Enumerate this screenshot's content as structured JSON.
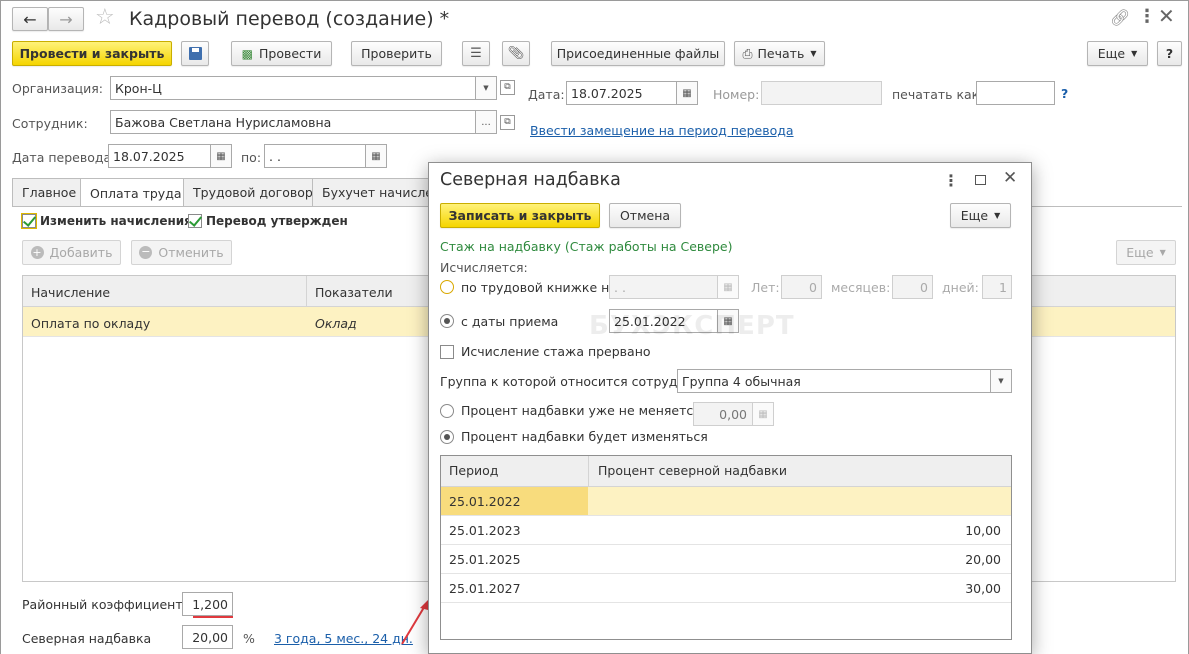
{
  "window": {
    "title": "Кадровый перевод (создание) *"
  },
  "toolbar": {
    "post_close": "Провести и закрыть",
    "post": "Провести",
    "check": "Проверить",
    "attached": "Присоединенные файлы",
    "print": "Печать",
    "more": "Еще",
    "help": "?"
  },
  "form": {
    "org_label": "Организация:",
    "org_value": "Крон-Ц",
    "date_label": "Дата:",
    "date_value": "18.07.2025",
    "number_label": "Номер:",
    "number_value": "",
    "print_as_label": "печатать как:",
    "print_as_value": "",
    "print_as_help": "?",
    "employee_label": "Сотрудник:",
    "employee_value": "Бажова Светлана Нурисламовна",
    "substitution_link": "Ввести замещение на период перевода",
    "transfer_date_label": "Дата перевода:",
    "transfer_date_value": "18.07.2025",
    "to_label": "по:",
    "to_value": " .  ."
  },
  "tabs": [
    "Главное",
    "Оплата труда",
    "Трудовой договор",
    "Бухучет начислен"
  ],
  "pay": {
    "change_accruals": "Изменить начисления",
    "approved": "Перевод утвержден",
    "add": "Добавить",
    "cancel": "Отменить",
    "more": "Еще",
    "columns": [
      "Начисление",
      "Показатели"
    ],
    "rows": [
      {
        "accrual": "Оплата по окладу",
        "indicator": "Оклад"
      }
    ],
    "regional_label": "Районный коэффициент",
    "regional_value": "1,200",
    "northern_label": "Северная надбавка",
    "northern_value": "20,00",
    "northern_unit": "%",
    "northern_link": "3 года, 5 мес., 24 дн."
  },
  "dialog": {
    "title": "Северная надбавка",
    "save_close": "Записать и закрыть",
    "cancel": "Отмена",
    "more": "Еще",
    "section": "Стаж на надбавку (Стаж работы на Севере)",
    "calculated": "Исчисляется:",
    "by_book": "по трудовой книжке на",
    "book_date": " .  .",
    "years_label": "Лет:",
    "years_value": "0",
    "months_label": "месяцев:",
    "months_value": "0",
    "days_label": "дней:",
    "days_value": "1",
    "from_hire": "с даты приема",
    "hire_date": "25.01.2022",
    "interrupted": "Исчисление стажа прервано",
    "group_label": "Группа к которой относится сотрудник:",
    "group_value": "Группа 4 обычная",
    "fixed_percent": "Процент надбавки уже не меняется",
    "fixed_value": "0,00",
    "changing_percent": "Процент надбавки будет изменяться",
    "columns": [
      "Период",
      "Процент северной надбавки"
    ],
    "rows": [
      {
        "period": "25.01.2022",
        "percent": ""
      },
      {
        "period": "25.01.2023",
        "percent": "10,00"
      },
      {
        "period": "25.01.2025",
        "percent": "20,00"
      },
      {
        "period": "25.01.2027",
        "percent": "30,00"
      }
    ]
  },
  "watermark": "БУХЭКСПЕРТ",
  "colors": {
    "accent": "#f5d500",
    "link": "#1b5faa",
    "section": "#2f8a3e",
    "selected_row": "#fdf2c2",
    "annotation": "#e0393e"
  }
}
